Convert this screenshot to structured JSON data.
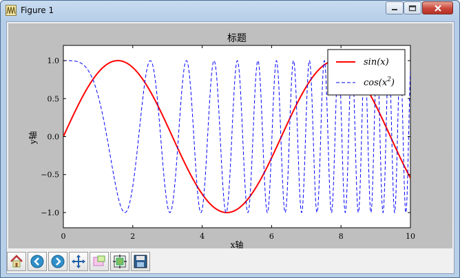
{
  "window": {
    "title": "Figure 1"
  },
  "toolbar": {
    "buttons": [
      {
        "name": "home"
      },
      {
        "name": "back"
      },
      {
        "name": "forward"
      },
      {
        "name": "pan"
      },
      {
        "name": "zoom"
      },
      {
        "name": "subplots"
      },
      {
        "name": "save"
      }
    ]
  },
  "chart_data": {
    "type": "line",
    "title": "标题",
    "xlabel": "x轴",
    "ylabel": "y轴",
    "xlim": [
      0,
      10
    ],
    "ylim": [
      -1.2,
      1.2
    ],
    "xticks": [
      "0",
      "2",
      "4",
      "6",
      "8",
      "10"
    ],
    "yticks": [
      "−1.0",
      "−0.5",
      "0.0",
      "0.5",
      "1.0"
    ],
    "legend_position": "top-right",
    "series": [
      {
        "name": "sin(x)",
        "function": "sin(x)",
        "color": "#ff0000",
        "style": "solid"
      },
      {
        "name": "cos(x²)",
        "function": "cos(x^2)",
        "color": "#0000ff",
        "style": "dashed"
      }
    ],
    "legend": {
      "sin_label": "sin(x)",
      "cos_label_base": "cos(x",
      "cos_sup": "2",
      "cos_close": ")"
    }
  }
}
